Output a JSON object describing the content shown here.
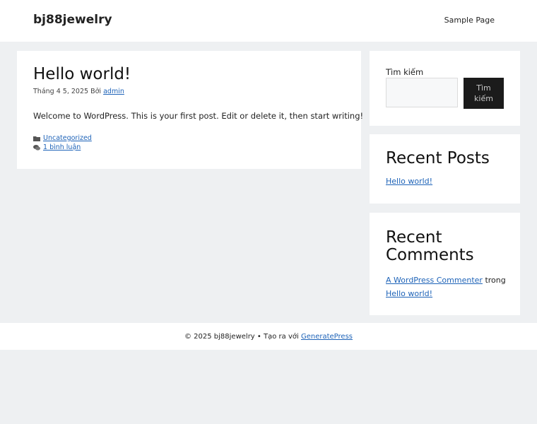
{
  "header": {
    "site_title": "bj88jewelry",
    "nav": [
      "Sample Page"
    ]
  },
  "post": {
    "title": "Hello world!",
    "date": "Tháng 4 5, 2025",
    "by": "Bởi",
    "author": "admin",
    "content": "Welcome to WordPress. This is your first post. Edit or delete it, then start writing!",
    "category": "Uncategorized",
    "comments": "1 bình luận"
  },
  "sidebar": {
    "search_label": "Tìm kiếm",
    "search_button_line1": "Tìm",
    "search_button_line2": "kiếm",
    "recent_posts_title": "Recent Posts",
    "recent_posts": [
      "Hello world!"
    ],
    "recent_comments_title": "Recent Comments",
    "comment_author": "A WordPress Commenter",
    "comment_connector": "trong",
    "comment_post": "Hello world!"
  },
  "footer": {
    "copyright": "© 2025 bj88jewelry",
    "separator": "•",
    "made_with": "Tạo ra với",
    "theme_link": "GeneratePress"
  },
  "icons": {
    "category": "folder-icon",
    "comments": "comments-icon"
  },
  "colors": {
    "background": "#eef0f2",
    "link": "#1e63b8",
    "button": "#1b1b1b"
  }
}
